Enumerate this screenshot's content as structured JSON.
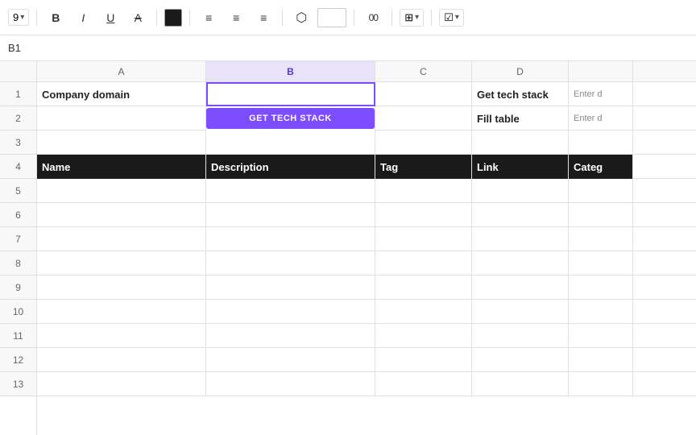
{
  "toolbar": {
    "font_size": "9",
    "bold_label": "B",
    "italic_label": "I",
    "underline_label": "U",
    "strikethrough_label": "A"
  },
  "cell_ref": "B1",
  "columns": [
    "A",
    "B",
    "C",
    "D"
  ],
  "rows": [
    1,
    2,
    3,
    4,
    5,
    6,
    7,
    8,
    9,
    10,
    11,
    12,
    13
  ],
  "cells": {
    "r1c1": "Company domain",
    "r1c3": "",
    "r1c4": "Get tech stack",
    "r1c5": "Enter d",
    "r2c4": "Fill table",
    "r2c5": "Enter d",
    "r4c1": "Name",
    "r4c2": "Description",
    "r4c3": "Tag",
    "r4c4": "Link",
    "r4c5": "Categ"
  },
  "get_tech_btn_label": "GET TECH STACK"
}
